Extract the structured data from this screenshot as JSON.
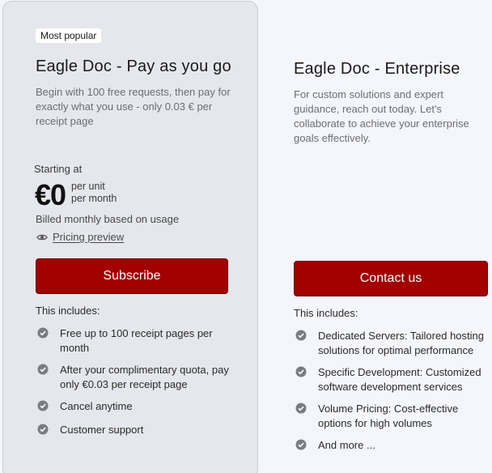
{
  "plans": [
    {
      "badge": "Most popular",
      "title": "Eagle Doc - Pay as you go",
      "description": "Begin with 100 free requests, then pay for exactly what you use - only 0.03 € per receipt page",
      "price_label": "Starting at",
      "price": "€0",
      "unit_line1": "per unit",
      "unit_line2": "per month",
      "billing": "Billed monthly based on usage",
      "preview_label": "Pricing preview",
      "button_label": "Subscribe",
      "includes_label": "This includes:",
      "features": [
        "Free up to 100 receipt pages per month",
        "After your complimentary quota, pay only €0.03 per receipt page",
        "Cancel anytime",
        "Customer support"
      ]
    },
    {
      "title": "Eagle Doc - Enterprise",
      "description": "For custom solutions and expert guidance, reach out today. Let's collaborate to achieve your enterprise goals effectively.",
      "button_label": "Contact us",
      "includes_label": "This includes:",
      "features": [
        "Dedicated Servers: Tailored hosting solutions for optimal performance",
        "Specific Development: Customized software development services",
        "Volume Pricing: Cost-effective options for high volumes",
        "And more ..."
      ]
    }
  ],
  "colors": {
    "accent": "#a30000",
    "card_bg": "#e5e7ec",
    "check_icon": "#7a7c82"
  },
  "icons": {
    "preview": "eye-icon",
    "feature": "check-circle-icon"
  }
}
